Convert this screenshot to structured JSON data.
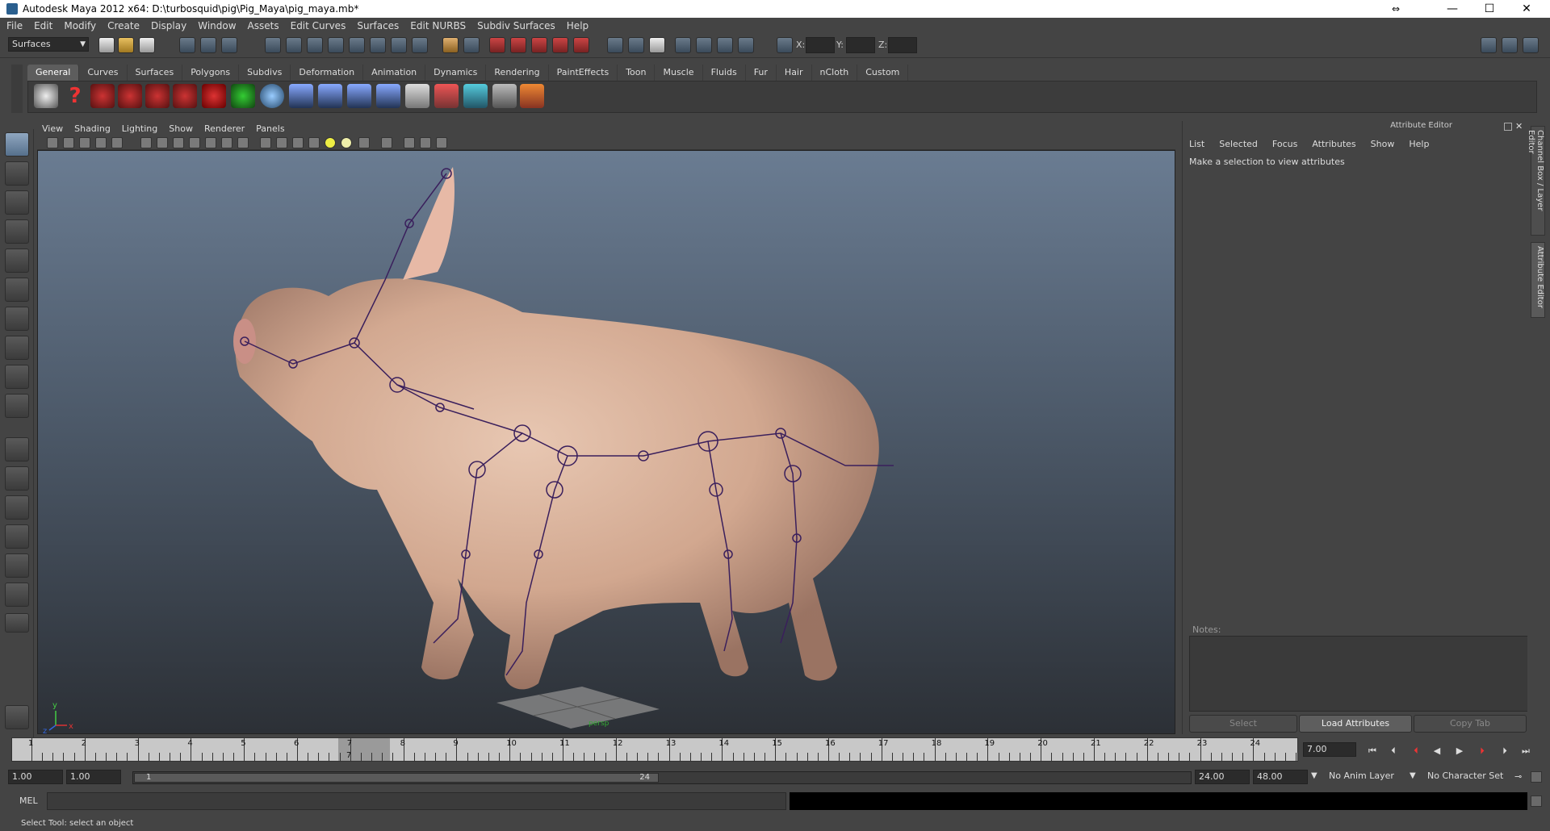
{
  "window": {
    "title": "Autodesk Maya 2012 x64: D:\\turbosquid\\pig\\Pig_Maya\\pig_maya.mb*",
    "controls": [
      "minimize-icon",
      "maximize-icon",
      "close-icon"
    ]
  },
  "menubar": {
    "items": [
      "File",
      "Edit",
      "Modify",
      "Create",
      "Display",
      "Window",
      "Assets",
      "Edit Curves",
      "Surfaces",
      "Edit NURBS",
      "Subdiv Surfaces",
      "Help"
    ]
  },
  "statusline": {
    "mode": "Surfaces",
    "coord_labels": [
      "X:",
      "Y:",
      "Z:"
    ]
  },
  "shelf": {
    "tabs": [
      "General",
      "Curves",
      "Surfaces",
      "Polygons",
      "Subdivs",
      "Deformation",
      "Animation",
      "Dynamics",
      "Rendering",
      "PaintEffects",
      "Toon",
      "Muscle",
      "Fluids",
      "Fur",
      "Hair",
      "nCloth",
      "Custom"
    ],
    "active_tab": "General"
  },
  "viewport": {
    "menu": [
      "View",
      "Shading",
      "Lighting",
      "Show",
      "Renderer",
      "Panels"
    ],
    "axis_labels": [
      "y",
      "x",
      "z"
    ],
    "grid_label": "persp"
  },
  "attribute_editor": {
    "title": "Attribute Editor",
    "menu": [
      "List",
      "Selected",
      "Focus",
      "Attributes",
      "Show",
      "Help"
    ],
    "message": "Make a selection to view attributes",
    "notes_label": "Notes:",
    "buttons": {
      "select": "Select",
      "load": "Load Attributes",
      "copy": "Copy Tab"
    }
  },
  "side_tabs": [
    "Channel Box / Layer Editor",
    "Attribute Editor"
  ],
  "time_slider": {
    "ticks": [
      "1",
      "2",
      "3",
      "4",
      "5",
      "6",
      "7",
      "8",
      "9",
      "10",
      "11",
      "12",
      "13",
      "14",
      "15",
      "16",
      "17",
      "18",
      "19",
      "20",
      "21",
      "22",
      "23",
      "24"
    ],
    "current_frame_marker": "7",
    "current_time": "7.00"
  },
  "range_slider": {
    "start_time": "1.00",
    "playback_start": "1.00",
    "range_min_label": "1",
    "range_max_label": "24",
    "playback_end": "24.00",
    "end_time": "48.00",
    "anim_layer": "No Anim Layer",
    "character_set": "No Character Set"
  },
  "command_line": {
    "label": "MEL"
  },
  "help_line": {
    "text": "Select Tool: select an object"
  },
  "colors": {
    "ui_bg": "#444444",
    "viewport_top": "#6a7c92",
    "viewport_bottom": "#2c3036",
    "skeleton": "#3a1f5c",
    "pig_skin": "#e2b9a0"
  }
}
